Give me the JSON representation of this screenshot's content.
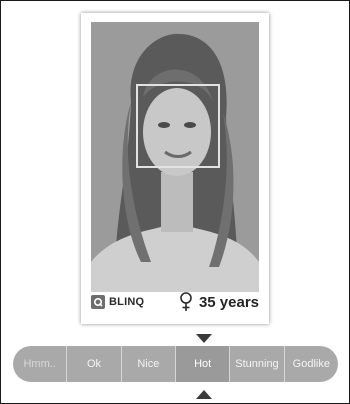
{
  "card": {
    "brand_name": "BLINQ",
    "brand_icon": "blinq-logo-icon",
    "gender_icon": "female-symbol-icon",
    "age_label": "35 years"
  },
  "rating": {
    "selected": "Hot",
    "options": [
      {
        "label": "Hmm..",
        "dim": true
      },
      {
        "label": "Ok"
      },
      {
        "label": "Nice"
      },
      {
        "label": "Hot"
      },
      {
        "label": "Stunning"
      },
      {
        "label": "Godlike"
      }
    ]
  },
  "colors": {
    "bar": "#a9a9a9",
    "text": "#262626"
  }
}
